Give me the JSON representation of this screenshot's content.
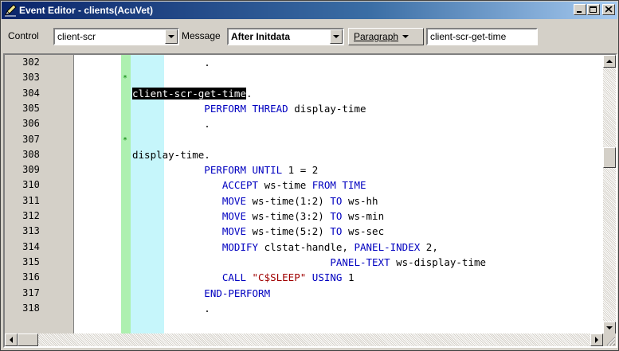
{
  "window": {
    "title": "Event Editor - clients(AcuVet)",
    "buttons": {
      "minimize": "_",
      "maximize": "□",
      "close": "×"
    }
  },
  "toolbar": {
    "control_label": "Control",
    "control_value": "client-scr",
    "message_label": "Message",
    "message_value": "After Initdata",
    "paragraph_button": "Paragraph",
    "paragraph_value": "client-scr-get-time"
  },
  "editor": {
    "lines": [
      {
        "num": "302",
        "star": false,
        "parts": [
          {
            "t": "            .",
            "c": "plain"
          }
        ]
      },
      {
        "num": "303",
        "star": true,
        "parts": []
      },
      {
        "num": "304",
        "star": false,
        "parts": [
          {
            "t": "client-scr-get-time",
            "c": "sel"
          },
          {
            "t": ".",
            "c": "plain"
          }
        ]
      },
      {
        "num": "305",
        "star": false,
        "parts": [
          {
            "t": "            PERFORM THREAD",
            "c": "kw"
          },
          {
            "t": " display-time",
            "c": "plain"
          }
        ]
      },
      {
        "num": "306",
        "star": false,
        "parts": [
          {
            "t": "            .",
            "c": "plain"
          }
        ]
      },
      {
        "num": "307",
        "star": true,
        "parts": []
      },
      {
        "num": "308",
        "star": false,
        "parts": [
          {
            "t": "display-time.",
            "c": "plain"
          }
        ]
      },
      {
        "num": "309",
        "star": false,
        "parts": [
          {
            "t": "            PERFORM UNTIL",
            "c": "kw"
          },
          {
            "t": " 1 = 2",
            "c": "plain"
          }
        ]
      },
      {
        "num": "310",
        "star": false,
        "parts": [
          {
            "t": "               ACCEPT",
            "c": "kw"
          },
          {
            "t": " ws-time ",
            "c": "plain"
          },
          {
            "t": "FROM TIME",
            "c": "kw"
          }
        ]
      },
      {
        "num": "311",
        "star": false,
        "parts": [
          {
            "t": "               MOVE",
            "c": "kw"
          },
          {
            "t": " ws-time(1:2) ",
            "c": "plain"
          },
          {
            "t": "TO",
            "c": "kw"
          },
          {
            "t": " ws-hh",
            "c": "plain"
          }
        ]
      },
      {
        "num": "312",
        "star": false,
        "parts": [
          {
            "t": "               MOVE",
            "c": "kw"
          },
          {
            "t": " ws-time(3:2) ",
            "c": "plain"
          },
          {
            "t": "TO",
            "c": "kw"
          },
          {
            "t": " ws-min",
            "c": "plain"
          }
        ]
      },
      {
        "num": "313",
        "star": false,
        "parts": [
          {
            "t": "               MOVE",
            "c": "kw"
          },
          {
            "t": " ws-time(5:2) ",
            "c": "plain"
          },
          {
            "t": "TO",
            "c": "kw"
          },
          {
            "t": " ws-sec",
            "c": "plain"
          }
        ]
      },
      {
        "num": "314",
        "star": false,
        "parts": [
          {
            "t": "               MODIFY",
            "c": "kw"
          },
          {
            "t": " clstat-handle, ",
            "c": "plain"
          },
          {
            "t": "PANEL-INDEX",
            "c": "kw"
          },
          {
            "t": " 2,",
            "c": "plain"
          }
        ]
      },
      {
        "num": "315",
        "star": false,
        "parts": [
          {
            "t": "                                 PANEL-TEXT",
            "c": "kw"
          },
          {
            "t": " ws-display-time",
            "c": "plain"
          }
        ]
      },
      {
        "num": "316",
        "star": false,
        "parts": [
          {
            "t": "               CALL",
            "c": "kw"
          },
          {
            "t": " \"C$SLEEP\"",
            "c": "str"
          },
          {
            "t": " USING",
            "c": "kw"
          },
          {
            "t": " 1",
            "c": "plain"
          }
        ]
      },
      {
        "num": "317",
        "star": false,
        "parts": [
          {
            "t": "            END-PERFORM",
            "c": "kw"
          }
        ]
      },
      {
        "num": "318",
        "star": false,
        "parts": [
          {
            "t": "            .",
            "c": "plain"
          }
        ]
      }
    ]
  }
}
